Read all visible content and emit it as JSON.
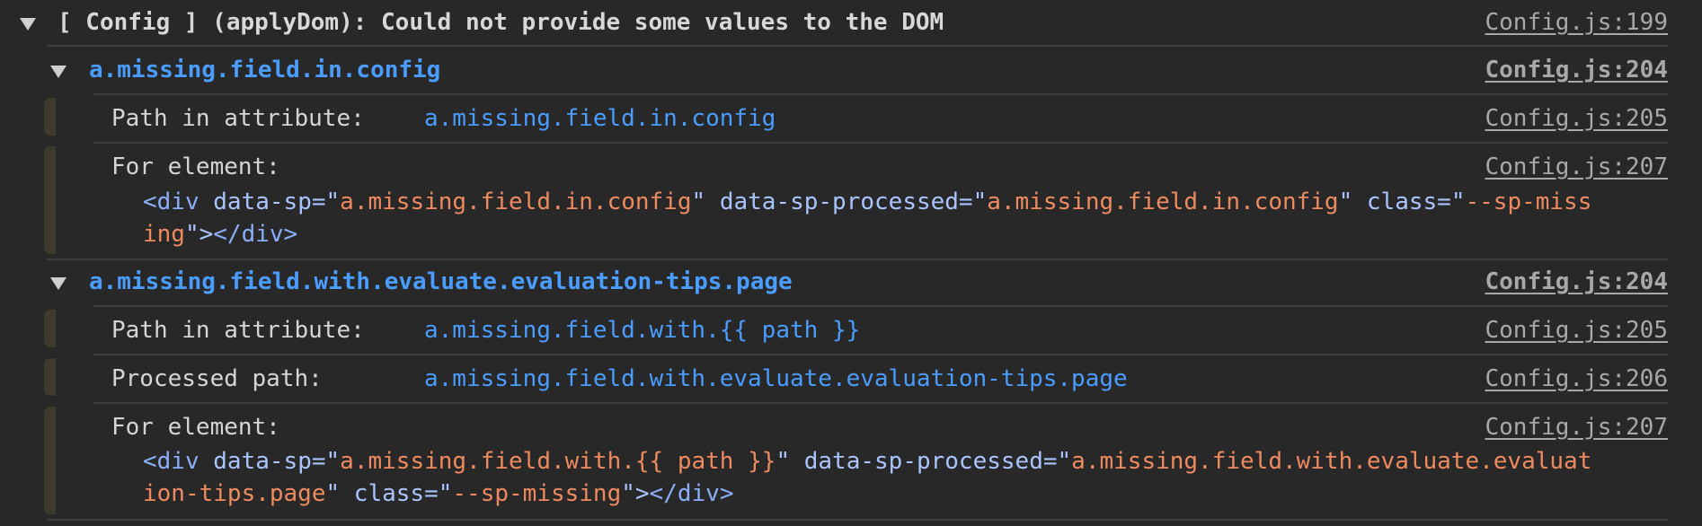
{
  "group": {
    "title": "[ Config ] (applyDom): Could not provide some values to the DOM",
    "source": "Config.js:199"
  },
  "entries": [
    {
      "key": "a.missing.field.in.config",
      "source": "Config.js:204",
      "path_label": "Path in attribute:",
      "path_value": "a.missing.field.in.config",
      "path_source": "Config.js:205",
      "element_label": "For element:",
      "element_source": "Config.js:207",
      "element_line1": {
        "t1": "<div ",
        "a1": "data-sp=\"",
        "v1": "a.missing.field.in.config",
        "a2": "\" data-sp-processed=\"",
        "v2": "a.missing.field.in.config",
        "a3": "\" class=\"",
        "v3": "--sp-miss"
      },
      "element_line2": {
        "v1": "ing",
        "a1": "\">",
        "t1": "</div>"
      }
    },
    {
      "key": "a.missing.field.with.evaluate.evaluation-tips.page",
      "source": "Config.js:204",
      "path_label": "Path in attribute:",
      "path_value": "a.missing.field.with.{{ path }}",
      "path_source": "Config.js:205",
      "processed_label": "Processed path:",
      "processed_value": "a.missing.field.with.evaluate.evaluation-tips.page",
      "processed_source": "Config.js:206",
      "element_label": "For element:",
      "element_source": "Config.js:207",
      "element_line1": {
        "t1": "<div ",
        "a1": "data-sp=\"",
        "v1": "a.missing.field.with.{{ path }}",
        "a2": "\" data-sp-processed=\"",
        "v2": "a.missing.field.with.evaluate.evaluat"
      },
      "element_line2": {
        "v1": "ion-tips.page",
        "a1": "\" class=\"",
        "v2": "--sp-missing",
        "a2": "\">",
        "t1": "</div>"
      }
    }
  ]
}
